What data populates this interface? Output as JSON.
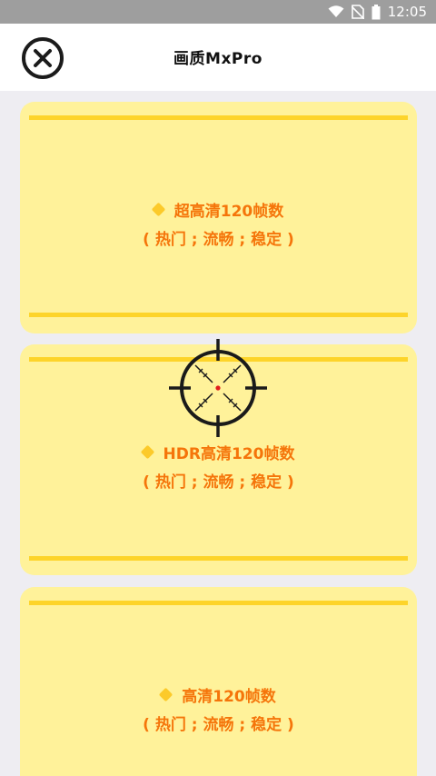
{
  "status_bar": {
    "time": "12:05",
    "icons": [
      "wifi-icon",
      "no-sim-icon",
      "battery-icon"
    ]
  },
  "header": {
    "title": "画质MxPro",
    "close_icon": "close-icon"
  },
  "options": [
    {
      "label": "超高清120帧数",
      "sub": "( 热门 ; 流畅 ; 稳定 )"
    },
    {
      "label": "HDR高清120帧数",
      "sub": "( 热门 ; 流畅 ; 稳定 )"
    },
    {
      "label": "高清120帧数",
      "sub": "( 热门 ; 流畅 ; 稳定 )"
    }
  ],
  "colors": {
    "card_bg": "#fff29a",
    "stripe": "#fdd42a",
    "label_text": "#f5750a",
    "diamond": "#fcca2a",
    "status_bar": "#9e9e9e"
  },
  "overlay": {
    "icon": "crosshair-icon"
  }
}
